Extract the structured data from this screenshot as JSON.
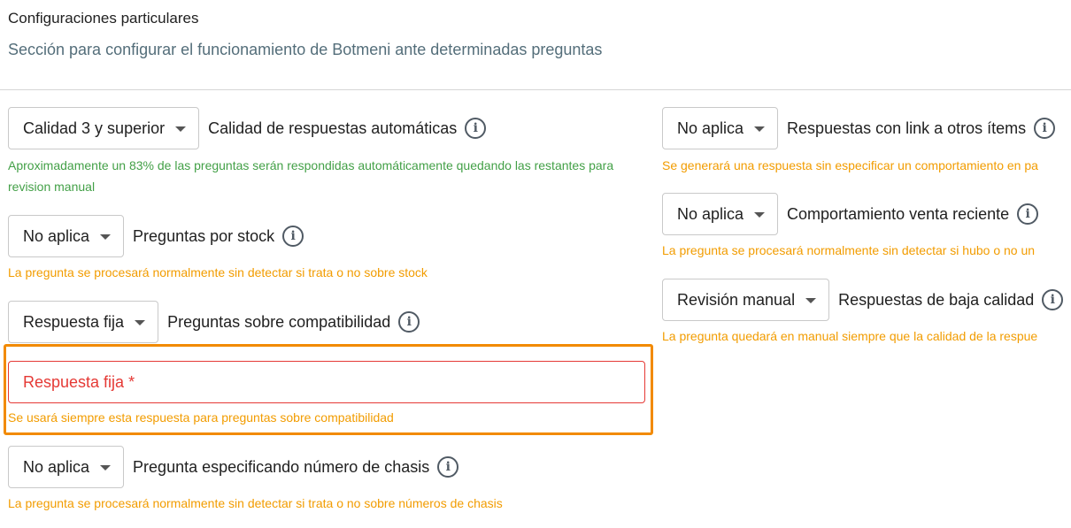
{
  "header": {
    "title": "Configuraciones particulares",
    "subtitle": "Sección para configurar el funcionamiento de Botmeni ante determinadas preguntas"
  },
  "left": {
    "quality": {
      "select": "Calidad 3 y superior",
      "label": "Calidad de respuestas automáticas",
      "hint": "Aproximadamente un 83% de las preguntas serán respondidas automáticamente quedando las restantes para revision manual"
    },
    "stock": {
      "select": "No aplica",
      "label": "Preguntas por stock",
      "hint": "La pregunta se procesará normalmente sin detectar si trata o no sobre stock"
    },
    "compat": {
      "select": "Respuesta fija",
      "label": "Preguntas sobre compatibilidad",
      "field_label": "Respuesta fija *",
      "hint": "Se usará siempre esta respuesta para preguntas sobre compatibilidad"
    },
    "chassis": {
      "select": "No aplica",
      "label": "Pregunta especificando número de chasis",
      "hint": "La pregunta se procesará normalmente sin detectar si trata o no sobre números de chasis"
    }
  },
  "right": {
    "links": {
      "select": "No aplica",
      "label": "Respuestas con link a otros ítems",
      "hint": "Se generará una respuesta sin especificar un comportamiento en pa"
    },
    "recent": {
      "select": "No aplica",
      "label": "Comportamiento venta reciente",
      "hint": "La pregunta se procesará normalmente sin detectar si hubo o no un"
    },
    "lowq": {
      "select": "Revisión manual",
      "label": "Respuestas de baja calidad",
      "hint": "La pregunta quedará en manual siempre que la calidad de la respue"
    }
  },
  "icons": {
    "info": "i"
  },
  "colors": {
    "success": "#43a047",
    "warning": "#f29c00",
    "error": "#e53935",
    "highlight": "#f28a00"
  }
}
